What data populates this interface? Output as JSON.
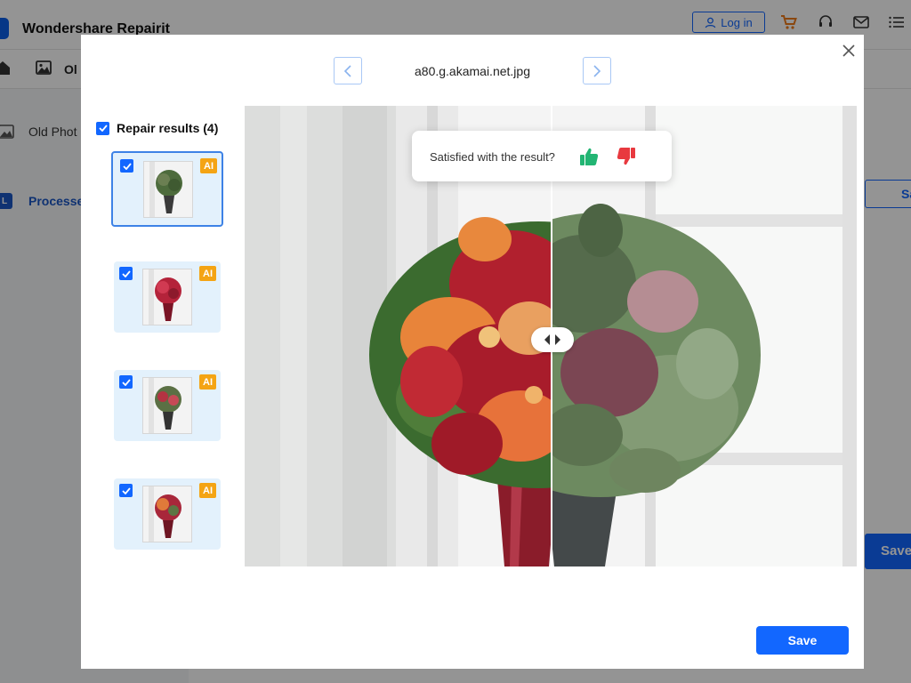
{
  "app": {
    "title": "Wondershare Repairit",
    "login_label": "Log in",
    "nav_tab_label": "Ol",
    "sidebar": [
      {
        "label": "Old Phot",
        "active": false
      },
      {
        "label": "Processe",
        "active": true,
        "badge": "L"
      }
    ],
    "right_button_partial": "Sa",
    "right_save_partial": "Save"
  },
  "modal": {
    "file_name": "a80.g.akamai.net.jpg",
    "results_label": "Repair results (4)",
    "results": [
      {
        "badge": "AI",
        "checked": true,
        "selected": true
      },
      {
        "badge": "AI",
        "checked": true,
        "selected": false
      },
      {
        "badge": "AI",
        "checked": true,
        "selected": false
      },
      {
        "badge": "AI",
        "checked": true,
        "selected": false
      }
    ],
    "feedback_question": "Satisfied with the result?",
    "save_label": "Save",
    "colors": {
      "accent": "#1267ff",
      "thumbs_up": "#22b573",
      "thumbs_down": "#e8393f",
      "ai_badge": "#f4a414",
      "card_bg": "#e3f1fc"
    }
  }
}
